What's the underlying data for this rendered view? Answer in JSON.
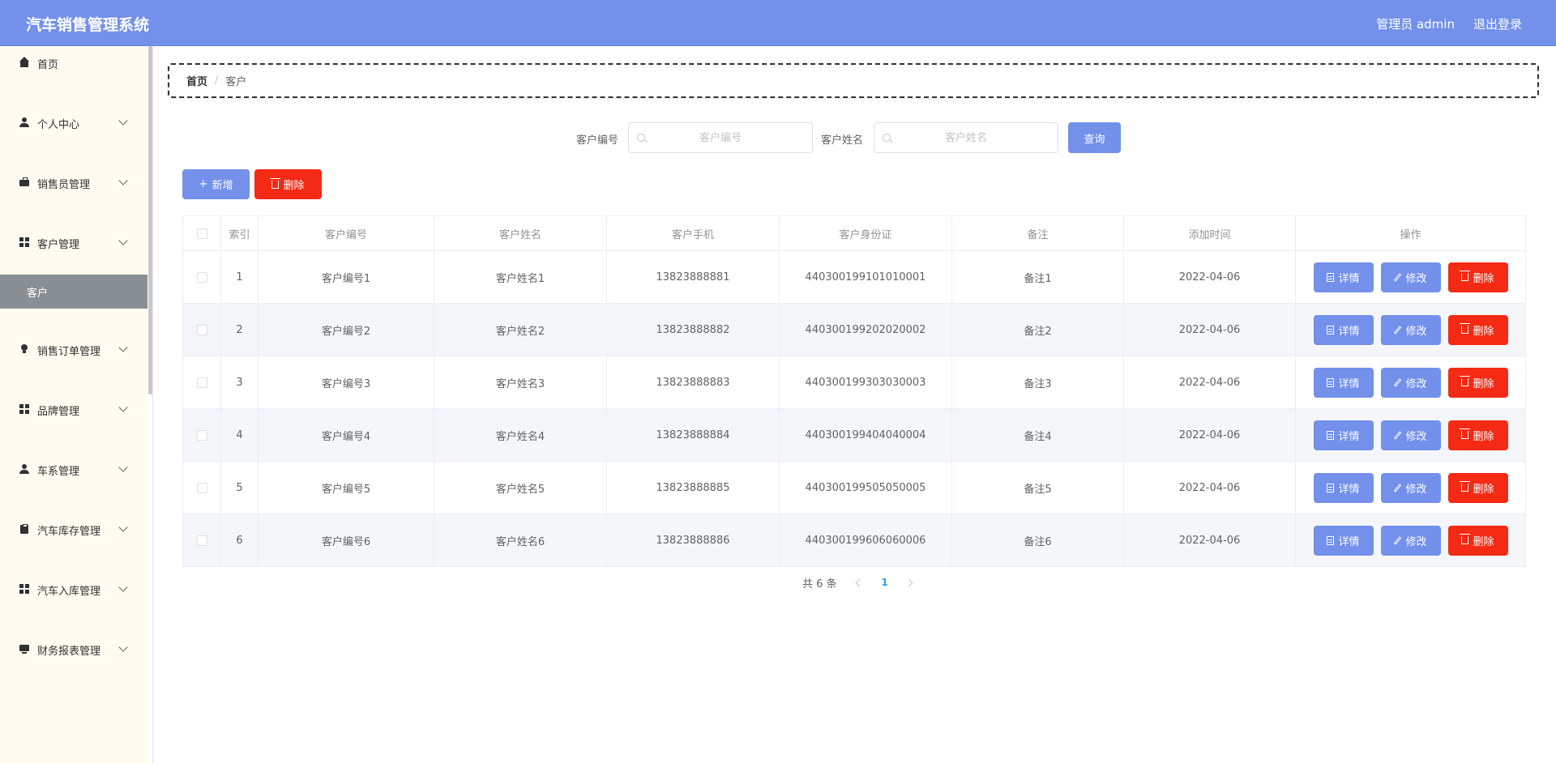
{
  "header": {
    "app_title": "汽车销售管理系统",
    "user_label": "管理员 admin",
    "logout_label": "退出登录"
  },
  "sidebar": {
    "items": [
      {
        "label": "首页",
        "icon": "home-icon"
      },
      {
        "label": "个人中心",
        "icon": "user-icon"
      },
      {
        "label": "销售员管理",
        "icon": "briefcase-icon"
      },
      {
        "label": "客户管理",
        "icon": "grid-icon"
      },
      {
        "label": "销售订单管理",
        "icon": "bulb-icon"
      },
      {
        "label": "品牌管理",
        "icon": "grid-icon"
      },
      {
        "label": "车系管理",
        "icon": "user-icon"
      },
      {
        "label": "汽车库存管理",
        "icon": "clipboard-icon"
      },
      {
        "label": "汽车入库管理",
        "icon": "grid-icon"
      },
      {
        "label": "财务报表管理",
        "icon": "monitor-icon"
      }
    ],
    "active_sub": "客户"
  },
  "breadcrumb": {
    "home": "首页",
    "separator": "/",
    "current": "客户"
  },
  "search": {
    "code_label": "客户编号",
    "code_placeholder": "客户编号",
    "code_value": "",
    "name_label": "客户姓名",
    "name_placeholder": "客户姓名",
    "name_value": "",
    "query_label": "查询"
  },
  "toolbar": {
    "add_label": "新增",
    "delete_label": "删除"
  },
  "table": {
    "headers": [
      "索引",
      "客户编号",
      "客户姓名",
      "客户手机",
      "客户身份证",
      "备注",
      "添加时间",
      "操作"
    ],
    "rows": [
      {
        "index": "1",
        "code": "客户编号1",
        "name": "客户姓名1",
        "phone": "13823888881",
        "id_card": "440300199101010001",
        "note": "备注1",
        "time": "2022-04-06"
      },
      {
        "index": "2",
        "code": "客户编号2",
        "name": "客户姓名2",
        "phone": "13823888882",
        "id_card": "440300199202020002",
        "note": "备注2",
        "time": "2022-04-06"
      },
      {
        "index": "3",
        "code": "客户编号3",
        "name": "客户姓名3",
        "phone": "13823888883",
        "id_card": "440300199303030003",
        "note": "备注3",
        "time": "2022-04-06"
      },
      {
        "index": "4",
        "code": "客户编号4",
        "name": "客户姓名4",
        "phone": "13823888884",
        "id_card": "440300199404040004",
        "note": "备注4",
        "time": "2022-04-06"
      },
      {
        "index": "5",
        "code": "客户编号5",
        "name": "客户姓名5",
        "phone": "13823888885",
        "id_card": "440300199505050005",
        "note": "备注5",
        "time": "2022-04-06"
      },
      {
        "index": "6",
        "code": "客户编号6",
        "name": "客户姓名6",
        "phone": "13823888886",
        "id_card": "440300199606060006",
        "note": "备注6",
        "time": "2022-04-06"
      }
    ],
    "op_detail": "详情",
    "op_edit": "修改",
    "op_delete": "删除"
  },
  "pagination": {
    "total_text": "共 6 条",
    "current_page": "1"
  },
  "colors": {
    "primary": "#7390ea",
    "danger": "#f42a14",
    "sidebar_bg": "#fffbf0",
    "sidebar_active": "#898f93"
  }
}
